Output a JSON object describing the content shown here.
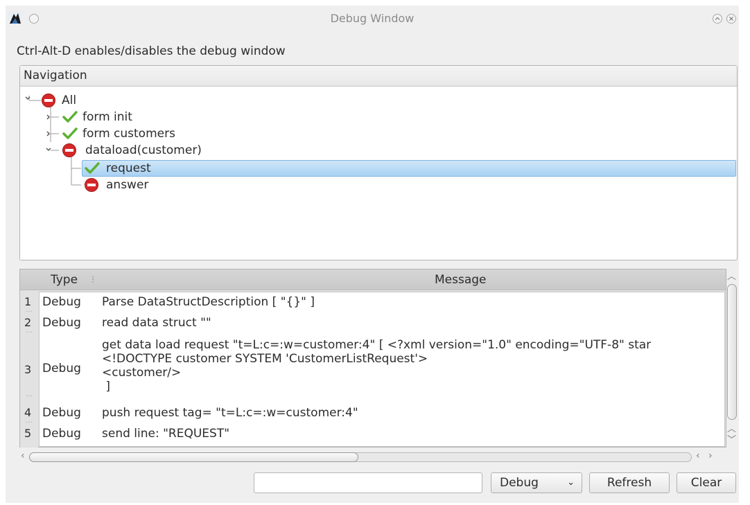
{
  "window": {
    "title": "Debug Window",
    "hint": "Ctrl-Alt-D enables/disables the debug window"
  },
  "navigation": {
    "header": "Navigation",
    "nodes": [
      {
        "label": "All",
        "status": "error-icon",
        "expanded": true
      },
      {
        "label": "form init",
        "status": "check-icon",
        "expanded": false
      },
      {
        "label": "form customers",
        "status": "check-icon",
        "expanded": false
      },
      {
        "label": "dataload(customer)",
        "status": "error-icon",
        "expanded": true
      },
      {
        "label": "request",
        "status": "check-icon",
        "selected": true
      },
      {
        "label": "answer",
        "status": "error-icon"
      }
    ]
  },
  "log": {
    "columns": {
      "type": "Type",
      "message": "Message"
    },
    "rows": [
      {
        "num": "1",
        "type": "Debug",
        "message": "Parse DataStructDescription [ \"{}\" ]"
      },
      {
        "num": "2",
        "type": "Debug",
        "message": "read data struct \"\""
      },
      {
        "num": "3",
        "type": "Debug",
        "message": "get data load request \"t=L:c=:w=customer:4\" [ <?xml version=\"1.0\" encoding=\"UTF-8\" star\n<!DOCTYPE customer SYSTEM 'CustomerListRequest'>\n<customer/>\n ]"
      },
      {
        "num": "4",
        "type": "Debug",
        "message": "push request tag= \"t=L:c=:w=customer:4\""
      },
      {
        "num": "5",
        "type": "Debug",
        "message": "send line: \"REQUEST\""
      }
    ]
  },
  "controls": {
    "filter_value": "",
    "level_select": "Debug",
    "refresh_label": "Refresh",
    "clear_label": "Clear"
  },
  "colors": {
    "error": "#d62828",
    "check": "#5bb030",
    "selection": "#a9d2f3"
  }
}
